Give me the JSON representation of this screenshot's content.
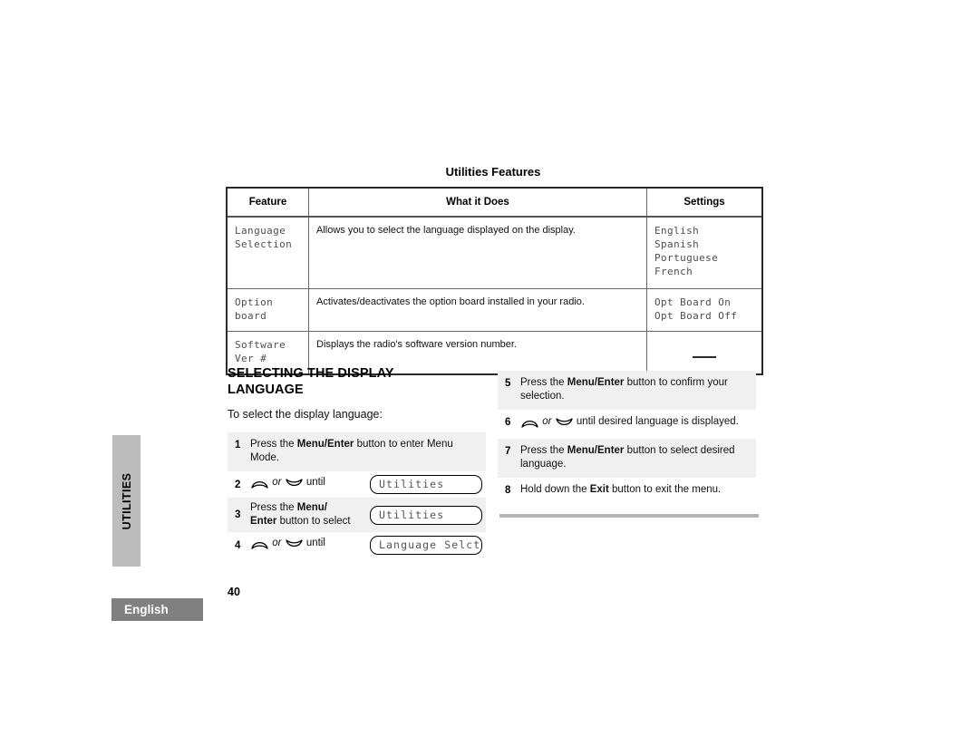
{
  "side_tab": {
    "label": "UTILITIES"
  },
  "footer": {
    "language_chip": "English",
    "page_number": "40"
  },
  "table": {
    "title": "Utilities Features",
    "headers": [
      "Feature",
      "What it Does",
      "Settings"
    ],
    "rows": [
      {
        "feature": "Language\nSelection",
        "what": "Allows you to select the language displayed on the display.",
        "settings": "English\nSpanish\nPortuguese\nFrench"
      },
      {
        "feature": "Option\nboard",
        "what": "Activates/deactivates the option board installed in your radio.",
        "settings": "Opt Board On\nOpt Board Off"
      },
      {
        "feature": "Software\nVer #",
        "what": "Displays the radio's software version number.",
        "settings": "—"
      }
    ]
  },
  "section": {
    "heading": "SELECTING THE DISPLAY LANGUAGE",
    "intro": "To select the display language:"
  },
  "steps_left": [
    {
      "num": "1",
      "text_parts": [
        {
          "t": "Press the ",
          "b": false
        },
        {
          "t": "Menu/Enter",
          "b": true
        },
        {
          "t": " button to enter Menu Mode.",
          "b": false
        }
      ],
      "shaded": true,
      "lcd": null
    },
    {
      "num": "2",
      "text_parts": [
        {
          "t": "__ARROWS__",
          "b": false
        },
        {
          "t": " until",
          "b": false
        }
      ],
      "shaded": false,
      "lcd": "Utilities"
    },
    {
      "num": "3",
      "text_parts": [
        {
          "t": "Press the ",
          "b": false
        },
        {
          "t": "Menu/",
          "b": true
        },
        {
          "t": "__BR__",
          "b": false
        },
        {
          "t": "Enter",
          "b": true
        },
        {
          "t": " button to select",
          "b": false
        }
      ],
      "shaded": true,
      "lcd": "Utilities"
    },
    {
      "num": "4",
      "text_parts": [
        {
          "t": "__ARROWS__",
          "b": false
        },
        {
          "t": " until",
          "b": false
        }
      ],
      "shaded": false,
      "lcd": "Language Selct"
    }
  ],
  "steps_right": [
    {
      "num": "5",
      "text_parts": [
        {
          "t": "Press the ",
          "b": false
        },
        {
          "t": "Menu/Enter",
          "b": true
        },
        {
          "t": " button to confirm your selection.",
          "b": false
        }
      ],
      "shaded": true,
      "lcd": null
    },
    {
      "num": "6",
      "text_parts": [
        {
          "t": "__ARROWS__",
          "b": false
        },
        {
          "t": " until desired language is displayed.",
          "b": false
        }
      ],
      "shaded": false,
      "lcd": null
    },
    {
      "num": "7",
      "text_parts": [
        {
          "t": "Press the ",
          "b": false
        },
        {
          "t": "Menu/Enter",
          "b": true
        },
        {
          "t": " button to select desired language.",
          "b": false
        }
      ],
      "shaded": true,
      "lcd": null
    },
    {
      "num": "8",
      "text_parts": [
        {
          "t": "Hold down the ",
          "b": false
        },
        {
          "t": "Exit",
          "b": true
        },
        {
          "t": " button to exit the menu.",
          "b": false
        }
      ],
      "shaded": false,
      "lcd": null
    }
  ],
  "icons": {
    "up_arrow": "arrow-up-dome-icon",
    "down_arrow": "arrow-down-dome-icon",
    "or_separator": "or"
  },
  "colors": {
    "tab_gray": "#bcbcbc",
    "chip_gray": "#808080",
    "shaded_row": "#f0f0f0",
    "rule_gray": "#b5b5b5",
    "table_border": "#6a6a6a",
    "lcd_text": "#555555"
  }
}
